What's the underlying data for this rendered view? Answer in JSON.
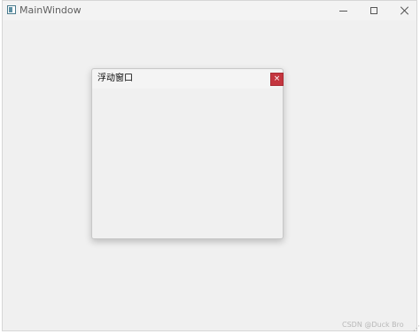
{
  "window": {
    "title": "MainWindow",
    "icon": "app-window-icon",
    "buttons": {
      "minimize_icon": "minimize-icon",
      "maximize_icon": "maximize-icon",
      "close_icon": "close-icon"
    }
  },
  "dock_widget": {
    "title": "浮动窗口",
    "close_label": "×",
    "close_color": "#c4363f"
  },
  "watermark": {
    "text": "CSDN @Duck Bro"
  }
}
